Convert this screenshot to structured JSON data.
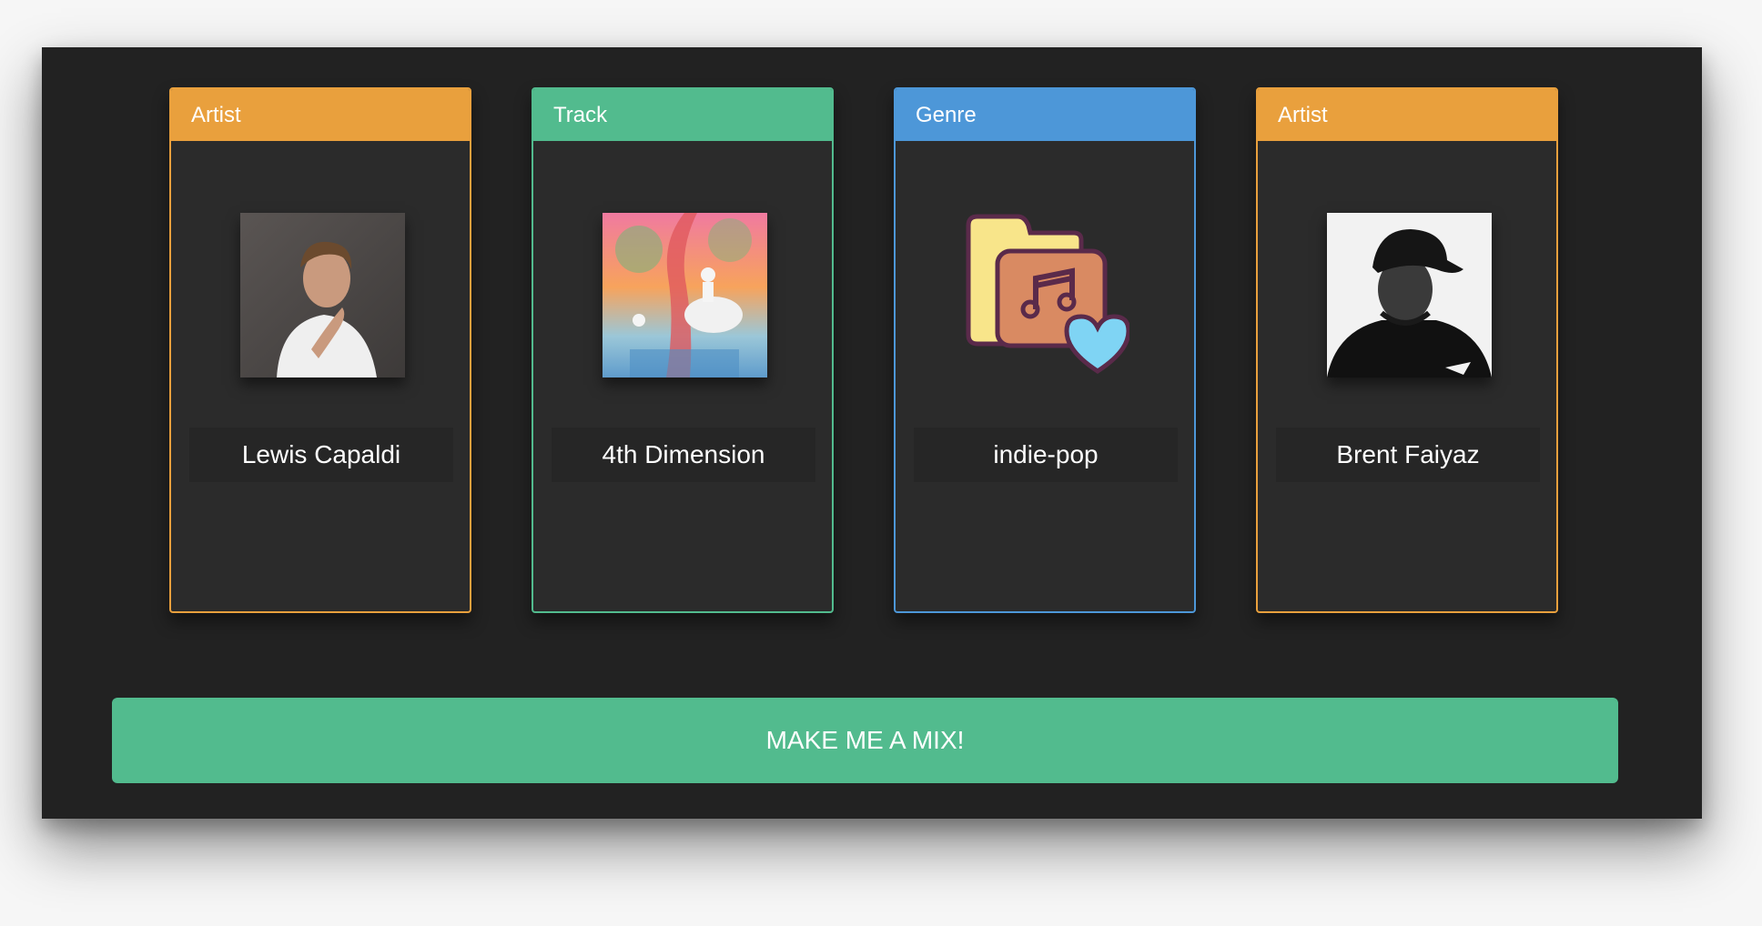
{
  "cards": [
    {
      "category": "Artist",
      "name": "Lewis Capaldi",
      "image": "artist-photo-lewis-capaldi"
    },
    {
      "category": "Track",
      "name": "4th Dimension",
      "image": "album-cover-kids-see-ghosts"
    },
    {
      "category": "Genre",
      "name": "indie-pop",
      "image": "music-folder-heart-icon"
    },
    {
      "category": "Artist",
      "name": "Brent Faiyaz",
      "image": "artist-photo-brent-faiyaz"
    }
  ],
  "actions": {
    "mix_button_label": "MAKE ME A MIX!"
  },
  "colors": {
    "artist": "#e9a03d",
    "track": "#52bb8e",
    "genre": "#4d97d8",
    "panel_bg": "#222222",
    "card_bg": "#2b2b2b"
  }
}
